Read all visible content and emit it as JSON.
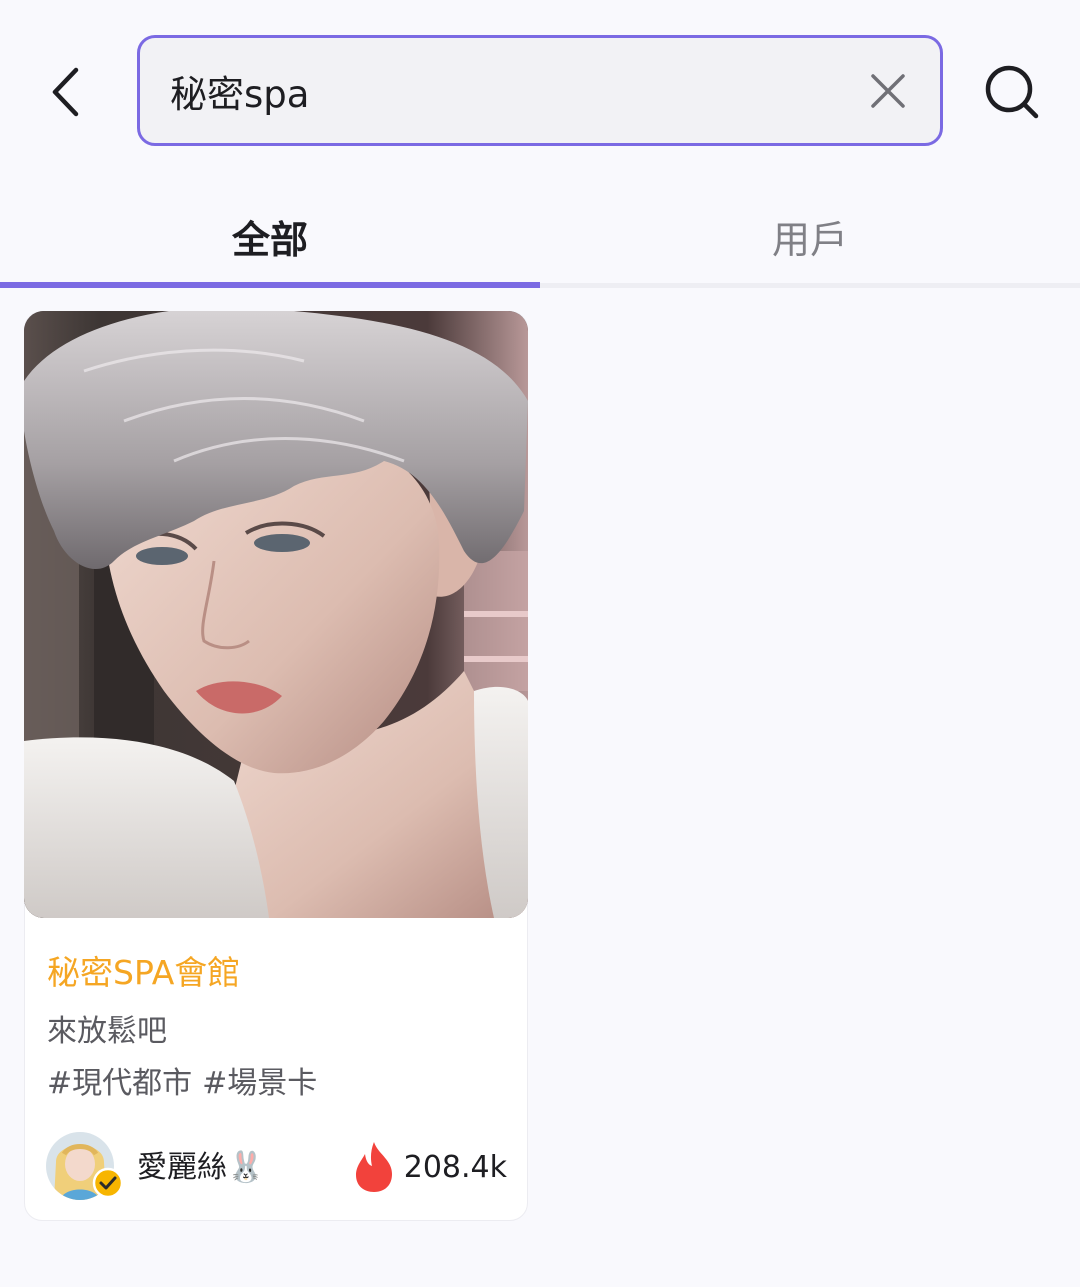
{
  "header": {
    "back_icon": "chevron-left-icon",
    "search": {
      "value": "秘密spa",
      "clear_icon": "close-icon"
    },
    "search_icon": "search-icon"
  },
  "tabs": [
    {
      "label": "全部",
      "active": true
    },
    {
      "label": "用戶",
      "active": false
    }
  ],
  "results": [
    {
      "title": "秘密SPA會館",
      "description": "來放鬆吧",
      "tags": [
        "#現代都市",
        "#場景卡"
      ],
      "author": {
        "name": "愛麗絲🐰",
        "verified": true
      },
      "popularity": {
        "icon": "flame-icon",
        "count": "208.4k"
      }
    }
  ],
  "colors": {
    "accent": "#7b6ae3",
    "card_title": "#f5a623",
    "flame": "#f2423c",
    "verified_badge": "#f7b500"
  }
}
